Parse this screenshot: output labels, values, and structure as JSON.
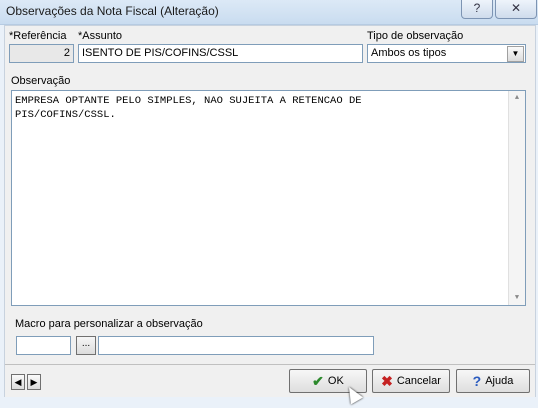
{
  "window": {
    "title": "Observações da Nota Fiscal (Alteração)",
    "help_glyph": "?",
    "close_glyph": "✕"
  },
  "form": {
    "referencia_label": "*Referência",
    "referencia_value": "2",
    "assunto_label": "*Assunto",
    "assunto_value": "ISENTO DE PIS/COFINS/CSSL",
    "tipo_label": "Tipo de observação",
    "tipo_value": "Ambos os tipos",
    "observacao_label": "Observação",
    "observacao_text": "EMPRESA OPTANTE PELO SIMPLES, NAO SUJEITA A RETENCAO DE\nPIS/COFINS/CSSL.",
    "macro_label": "Macro para personalizar a observação",
    "macro_code": "",
    "macro_desc": "",
    "macro_browse": "..."
  },
  "buttons": {
    "ok": "OK",
    "cancel": "Cancelar",
    "help": "Ajuda",
    "prev": "◀",
    "next": "▶"
  },
  "icons": {
    "ok": "check-icon",
    "cancel": "x-icon",
    "help": "question-icon"
  }
}
